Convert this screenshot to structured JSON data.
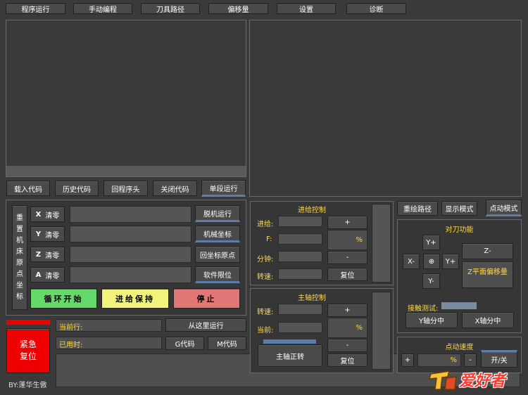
{
  "tabs": [
    "程序运行",
    "手动编程",
    "刀具路径",
    "偏移量",
    "设置",
    "诊断"
  ],
  "code_buttons": [
    "载入代码",
    "历史代码",
    "回程序头",
    "关闭代码",
    "单段运行"
  ],
  "axes": [
    {
      "label": "X",
      "action": "清零"
    },
    {
      "label": "Y",
      "action": "清零"
    },
    {
      "label": "Z",
      "action": "清零"
    },
    {
      "label": "A",
      "action": "清零"
    }
  ],
  "reset_machine_origin": "重\n置\n机\n床\n原\n点\n坐\n标",
  "side_buttons": [
    "脱机运行",
    "机械坐标",
    "回坐标原点",
    "软件限位"
  ],
  "run_buttons": {
    "start": "循环开始",
    "hold": "进给保持",
    "stop": "停止"
  },
  "estop": {
    "line1": "紧急",
    "line2": "复位"
  },
  "author": "BY:蓬华生傲",
  "current_line_label": "当前行:",
  "run_from_here": "从这里运行",
  "elapsed_label": "已用时:",
  "g_code": "G代码",
  "m_code": "M代码",
  "feed_control": {
    "title": "进给控制",
    "feed_label": "进给:",
    "f_label": "F:",
    "per_min_label": "分钟:",
    "speed_label": "转速:",
    "plus": "+",
    "percent": "%",
    "minus": "-",
    "reset": "复位"
  },
  "spindle_control": {
    "title": "主轴控制",
    "speed_label": "转速:",
    "current_label": "当前:",
    "plus": "+",
    "percent": "%",
    "minus": "-",
    "reset": "复位",
    "forward": "主轴正转"
  },
  "view_buttons": [
    "重绘路径",
    "显示模式",
    "点动模式"
  ],
  "tool_setting": {
    "title": "对刀功能",
    "y_plus_top": "Y+",
    "x_minus": "X-",
    "center": "⊕",
    "y_plus_right": "Y+",
    "y_minus": "Y-",
    "z_minus": "Z-",
    "z_offset": "Z平面偏移量",
    "probe_test": "接触测试:",
    "y_center": "Y轴分中",
    "x_center": "X轴分中"
  },
  "jog_speed": {
    "title": "点动速度",
    "plus": "+",
    "percent": "%",
    "minus": "-",
    "toggle": "开/关"
  },
  "watermark": "爱好者",
  "colors": {
    "start": "#66d96b",
    "hold": "#f1f37a",
    "stop": "#e07676",
    "estop": "#ee0000",
    "accent_underline": "#5a7ea8",
    "label_yellow": "#ffd84a"
  }
}
